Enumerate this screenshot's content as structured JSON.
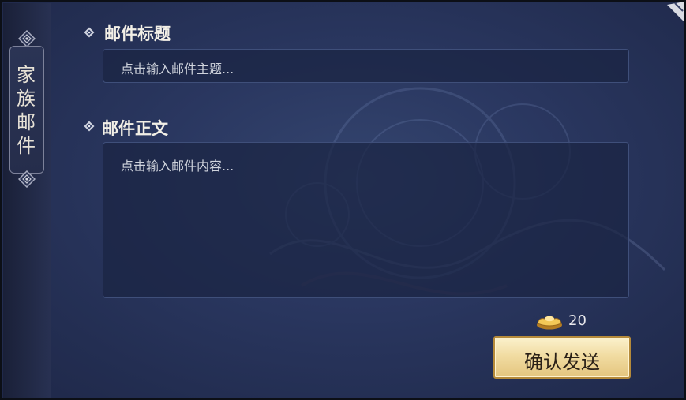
{
  "sidebar": {
    "tab_label": "家族邮件"
  },
  "mail": {
    "subject_title": "邮件标题",
    "subject_placeholder": "点击输入邮件主题...",
    "body_title": "邮件正文",
    "body_placeholder": "点击输入邮件内容..."
  },
  "footer": {
    "cost_value": "20",
    "send_label": "确认发送"
  },
  "icons": {
    "tab_ornament": "diamond-ornament-icon",
    "section_bullet": "diamond-bullet-icon",
    "cost": "gold-ingot-icon",
    "close": "close-corner-icon"
  },
  "colors": {
    "panel_bg": "#2a3760",
    "button_gold": "#f1dca2",
    "button_border": "#b58a3a"
  }
}
